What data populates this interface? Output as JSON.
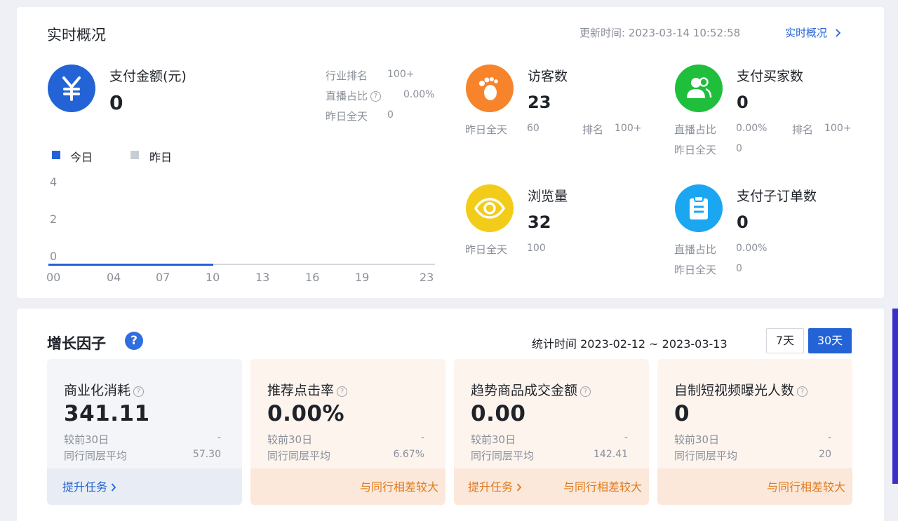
{
  "realtime": {
    "title": "实时概况",
    "update_label": "更新时间:",
    "update_time": "2023-03-14 10:52:58",
    "link_label": "实时概况",
    "pay_amount": {
      "label": "支付金额(元)",
      "value": "0",
      "industry_rank_label": "行业排名",
      "industry_rank_value": "100+",
      "live_share_label": "直播占比",
      "live_share_value": "0.00%",
      "yesterday_label": "昨日全天",
      "yesterday_value": "0",
      "icon": "yuan-icon",
      "color": "#2463d6"
    },
    "legend": {
      "today": "今日",
      "yesterday": "昨日",
      "today_color": "#2463d6",
      "yesterday_color": "#c8ccd3"
    },
    "chart": {
      "y_ticks": [
        "4",
        "2",
        "0"
      ],
      "x_ticks": [
        "00",
        "04",
        "07",
        "10",
        "13",
        "16",
        "19",
        "23"
      ]
    },
    "visitors": {
      "label": "访客数",
      "value": "23",
      "yesterday_label": "昨日全天",
      "yesterday_value": "60",
      "rank_label": "排名",
      "rank_value": "100+",
      "icon": "footprint-icon",
      "color": "#f7842b"
    },
    "buyers": {
      "label": "支付买家数",
      "value": "0",
      "live_share_label": "直播占比",
      "live_share_value": "0.00%",
      "rank_label": "排名",
      "rank_value": "100+",
      "yesterday_label": "昨日全天",
      "yesterday_value": "0",
      "icon": "users-icon",
      "color": "#1fbf3c"
    },
    "views": {
      "label": "浏览量",
      "value": "32",
      "yesterday_label": "昨日全天",
      "yesterday_value": "100",
      "icon": "eye-icon",
      "color": "#f2cc19"
    },
    "orders": {
      "label": "支付子订单数",
      "value": "0",
      "live_share_label": "直播占比",
      "live_share_value": "0.00%",
      "yesterday_label": "昨日全天",
      "yesterday_value": "0",
      "icon": "clipboard-icon",
      "color": "#1ba6f2"
    }
  },
  "growth": {
    "title": "增长因子",
    "stat_label": "统计时间",
    "stat_range": "2023-02-12 ~ 2023-03-13",
    "ranges": [
      "7天",
      "30天"
    ],
    "active_range": "30天",
    "cards": [
      {
        "label": "商业化消耗",
        "value": "341.11",
        "compare_label": "较前30日",
        "compare_value": "-",
        "peer_label": "同行同层平均",
        "peer_value": "57.30",
        "task_link": "提升任务",
        "gap_link": ""
      },
      {
        "label": "推荐点击率",
        "value": "0.00%",
        "compare_label": "较前30日",
        "compare_value": "-",
        "peer_label": "同行同层平均",
        "peer_value": "6.67%",
        "task_link": "",
        "gap_link": "与同行相差较大"
      },
      {
        "label": "趋势商品成交金额",
        "value": "0.00",
        "compare_label": "较前30日",
        "compare_value": "-",
        "peer_label": "同行同层平均",
        "peer_value": "142.41",
        "task_link": "提升任务",
        "gap_link": "与同行相差较大"
      },
      {
        "label": "自制短视频曝光人数",
        "value": "0",
        "compare_label": "较前30日",
        "compare_value": "-",
        "peer_label": "同行同层平均",
        "peer_value": "20",
        "task_link": "",
        "gap_link": "与同行相差较大"
      }
    ]
  }
}
